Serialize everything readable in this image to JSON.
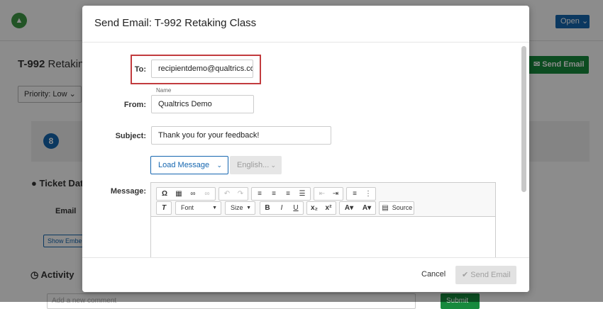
{
  "background": {
    "open_label": "Open",
    "ticket_id": "T-992",
    "ticket_title_rest": "Retakin",
    "send_email_label": "Send Email",
    "priority_label": "Priority: Low",
    "badge_number": "8",
    "ticket_data_label": "Ticket Dat",
    "email_label": "Email",
    "show_label": "Show Embe",
    "activity_label": "Activity",
    "comment_placeholder": "Add a new comment",
    "submit_label": "Submit"
  },
  "modal": {
    "title": "Send Email: T-992 Retaking Class",
    "to_label": "To:",
    "to_value": "recipientdemo@qualtrics.co",
    "name_hint": "Name",
    "from_label": "From:",
    "from_value": "Qualtrics Demo",
    "subject_label": "Subject:",
    "subject_value": "Thank you for your feedback!",
    "load_message_label": "Load Message",
    "language_label": "English...",
    "message_label": "Message:",
    "toolbar": {
      "font_label": "Font",
      "size_label": "Size",
      "bold": "B",
      "italic": "I",
      "underline": "U",
      "source_label": "Source"
    },
    "cancel_label": "Cancel",
    "send_label": "Send Email"
  },
  "colors": {
    "accent_blue": "#1566b0",
    "brand_green": "#178a3d",
    "highlight_red": "#c23b3e"
  }
}
